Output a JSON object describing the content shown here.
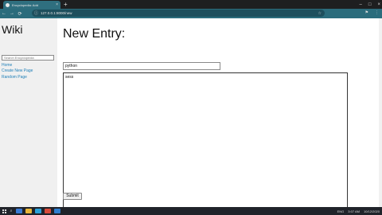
{
  "browser": {
    "tab_title": "Encyclopedia: Add",
    "tab_close": "×",
    "new_tab": "+",
    "win_minimize": "–",
    "win_maximize": "□",
    "win_close": "×",
    "back": "←",
    "forward": "→",
    "reload": "⟳",
    "info_icon": "ⓘ",
    "url": "127.0.0.1:8000/new",
    "star": "☆",
    "ext_icon": "⚑",
    "menu_icon": "⋮"
  },
  "sidebar": {
    "title": "Wiki",
    "search_placeholder": "Search Encyclopedia",
    "links": [
      "Home",
      "Create New Page",
      "Random Page"
    ]
  },
  "main": {
    "heading": "New Entry:",
    "title_value": "python",
    "content_value": "sess",
    "submit_label": "Submit"
  },
  "taskbar": {
    "search_icon": "⌕",
    "lang": "ENG",
    "time": "3:07 AM",
    "date": "10/12/2020"
  }
}
